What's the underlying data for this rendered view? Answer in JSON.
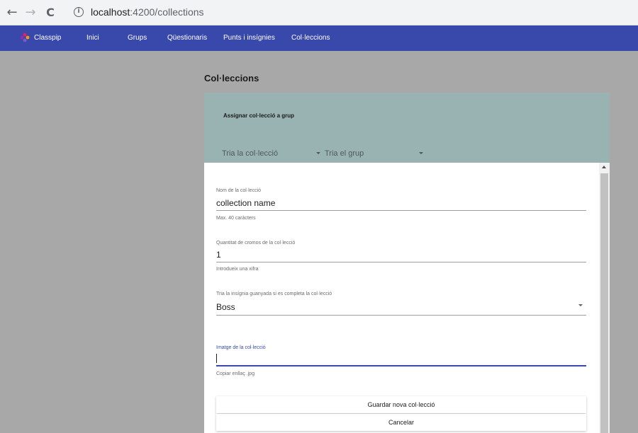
{
  "browser": {
    "url_host": "localhost",
    "url_path": ":4200/collections",
    "back_glyph": "←",
    "forward_glyph": "→",
    "reload_glyph": "C",
    "info_glyph": "i"
  },
  "navbar": {
    "brand": "Classpip",
    "items": [
      "Inici",
      "Grups",
      "Qüestionaris",
      "Punts i insígnies",
      "Col·leccions"
    ],
    "color": "#3949ab"
  },
  "page": {
    "title": "Col·leccions",
    "card_title": "Assignar col·lecció a grup",
    "select_collection": "Tria la col·lecció",
    "select_group": "Tria el grup"
  },
  "dialog": {
    "name_label": "Nom de la col·lecció",
    "name_value": "collection name",
    "name_hint": "Max. 40 caràcters",
    "count_label": "Quantitat de cromos de la col·lecció",
    "count_value": "1",
    "count_hint": "Introdueix una xifra",
    "badge_label": "Tria la insígnia guanyada si es completa la col·lecció",
    "badge_value": "Boss",
    "image_label": "Imatge de la col·lecció",
    "image_value": "",
    "image_hint": "Copiar enllaç .jpg",
    "save_button": "Guardar nova col·lecció",
    "cancel_button": "Cancelar"
  }
}
